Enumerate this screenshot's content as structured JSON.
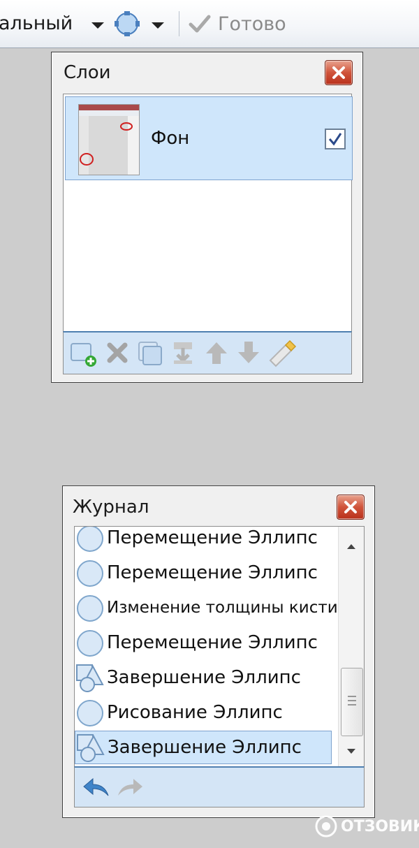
{
  "toolbar": {
    "mode_label": "альный",
    "done_label": "Готово"
  },
  "layers_panel": {
    "title": "Слои",
    "layer": {
      "name": "Фон",
      "visible": true
    },
    "tools": [
      "add-layer-icon",
      "delete-layer-icon",
      "duplicate-layer-icon",
      "merge-down-icon",
      "move-up-icon",
      "move-down-icon",
      "layer-properties-icon"
    ]
  },
  "history_panel": {
    "title": "Журнал",
    "items": [
      {
        "label": "Перемещение Эллипс",
        "icon": "ellipse-icon"
      },
      {
        "label": "Перемещение Эллипс",
        "icon": "ellipse-icon"
      },
      {
        "label": "Изменение толщины кисти",
        "icon": "ellipse-icon"
      },
      {
        "label": "Перемещение Эллипс",
        "icon": "ellipse-icon"
      },
      {
        "label": "Завершение Эллипс",
        "icon": "shapes-finish-icon"
      },
      {
        "label": "Рисование Эллипс",
        "icon": "ellipse-icon"
      },
      {
        "label": "Завершение Эллипс",
        "icon": "shapes-finish-icon",
        "selected": true
      }
    ],
    "tools": [
      "undo-icon",
      "redo-icon"
    ]
  },
  "watermark": {
    "text": "ОТЗОВИК"
  },
  "colors": {
    "selection_bg": "#cfe6fb",
    "close_red": "#c8432b",
    "toolbar_blue": "#d4e5f6"
  }
}
